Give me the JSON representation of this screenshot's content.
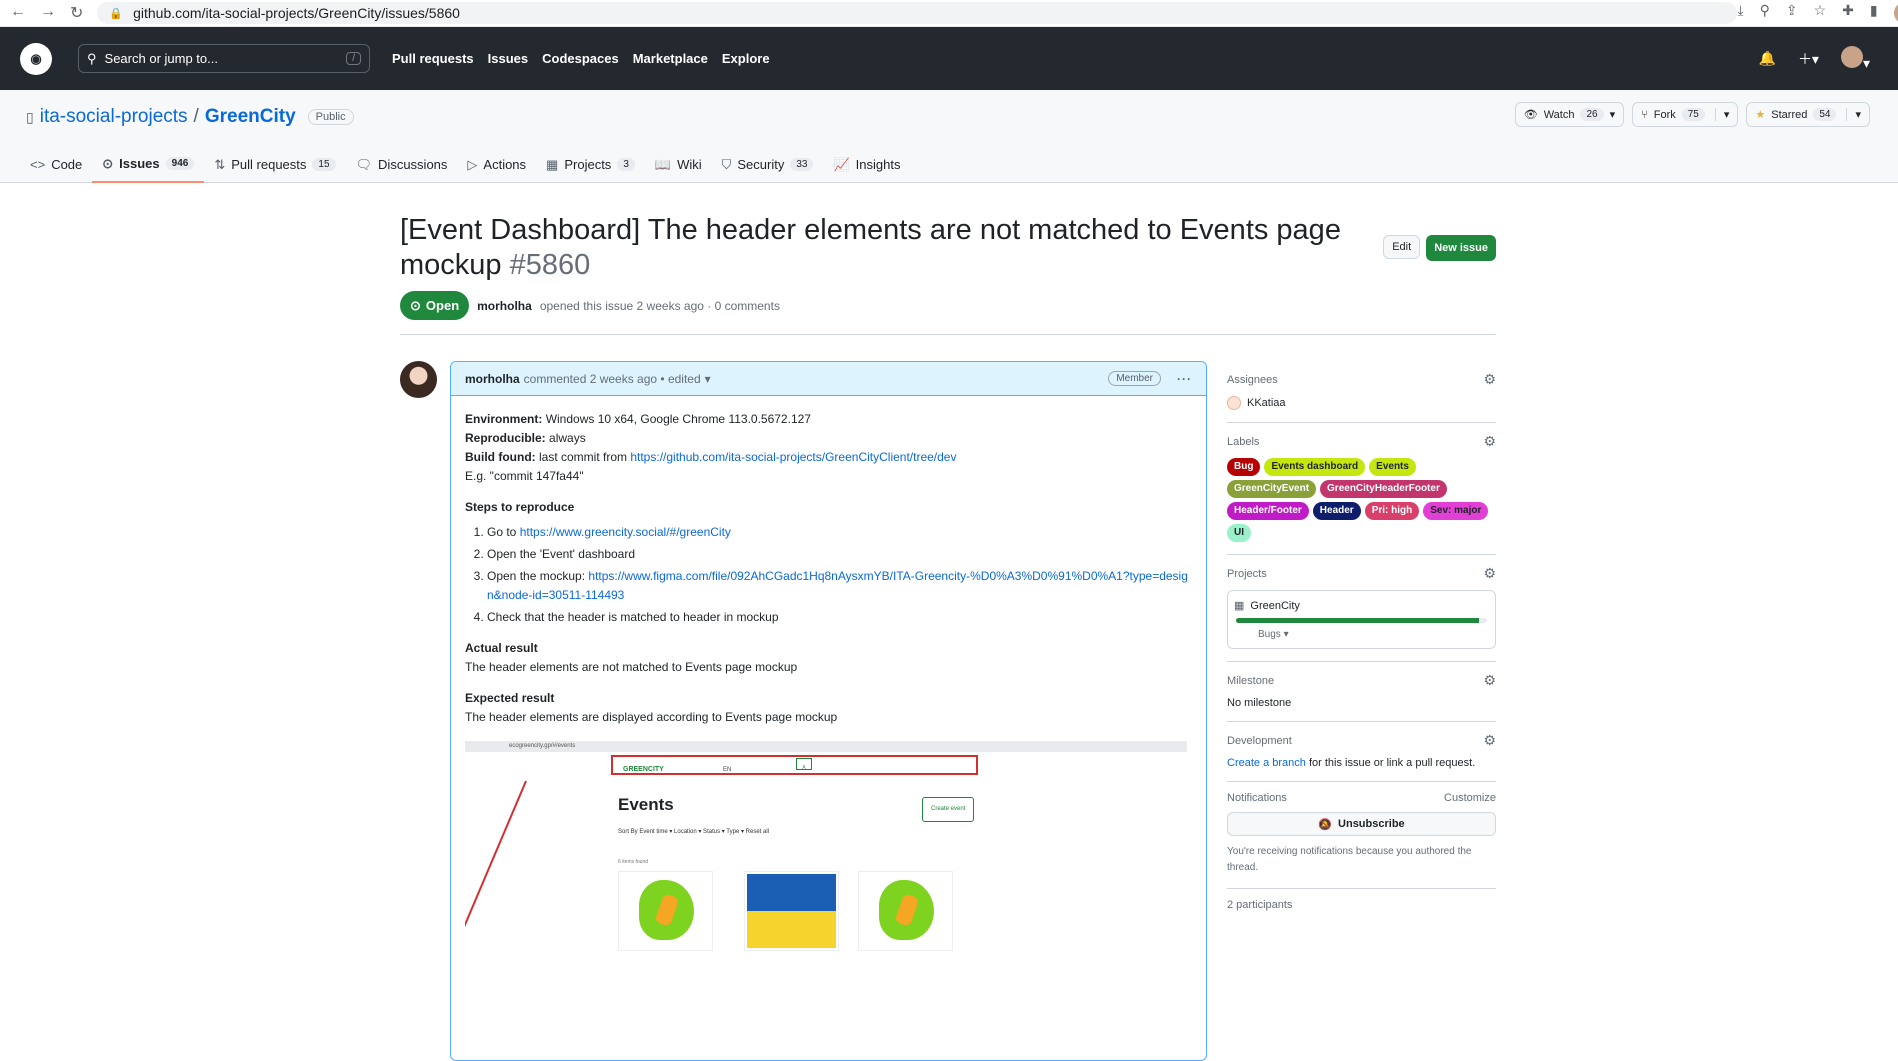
{
  "browser": {
    "url": "github.com/ita-social-projects/GreenCity/issues/5860"
  },
  "header": {
    "search_placeholder": "Search or jump to...",
    "search_shortcut": "/",
    "nav": [
      "Pull requests",
      "Issues",
      "Codespaces",
      "Marketplace",
      "Explore"
    ]
  },
  "repo": {
    "owner": "ita-social-projects",
    "separator": "/",
    "name": "GreenCity",
    "visibility": "Public",
    "watch": {
      "label": "Watch",
      "count": "26"
    },
    "fork": {
      "label": "Fork",
      "count": "75"
    },
    "star": {
      "label": "Starred",
      "count": "54"
    },
    "tabs": [
      {
        "label": "Code",
        "count": ""
      },
      {
        "label": "Issues",
        "count": "946"
      },
      {
        "label": "Pull requests",
        "count": "15"
      },
      {
        "label": "Discussions",
        "count": ""
      },
      {
        "label": "Actions",
        "count": ""
      },
      {
        "label": "Projects",
        "count": "3"
      },
      {
        "label": "Wiki",
        "count": ""
      },
      {
        "label": "Security",
        "count": "33"
      },
      {
        "label": "Insights",
        "count": ""
      }
    ]
  },
  "issue": {
    "title": "[Event Dashboard] The header elements are not matched to Events page mockup",
    "number": "#5860",
    "state": "Open",
    "author": "morholha",
    "meta_text": "opened this issue 2 weeks ago · 0 comments",
    "edit_label": "Edit",
    "new_issue_label": "New issue"
  },
  "comment": {
    "author": "morholha",
    "meta": "commented 2 weeks ago • edited",
    "role": "Member",
    "env_label": "Environment:",
    "env_value": "Windows 10 x64, Google Chrome 113.0.5672.127",
    "repro_label": "Reproducible:",
    "repro_value": "always",
    "build_label": "Build found:",
    "build_value": "last commit from",
    "build_link": "https://github.com/ita-social-projects/GreenCityClient/tree/dev",
    "example": "E.g. \"commit 147fa44\"",
    "steps_title": "Steps to reproduce",
    "step1_text": "Go to",
    "step1_link": "https://www.greencity.social/#/greenCity",
    "step2": "Open the 'Event' dashboard",
    "step3_text": "Open the mockup:",
    "step3_link": "https://www.figma.com/file/092AhCGadc1Hq8nAysxmYB/ITA-Greencity-%D0%A3%D0%91%D0%A1?type=design&node-id=30511-114493",
    "step4": "Check that the header is matched to header in mockup",
    "actual_title": "Actual result",
    "actual_text": "The header elements are not matched to Events page mockup",
    "expected_title": "Expected result",
    "expected_text": "The header elements are displayed according to Events page mockup",
    "screenshot": {
      "url": "ecogreencity.gp/#/events",
      "logo": "GREENCITY",
      "lang": "EN",
      "heading": "Events",
      "create": "Create event",
      "sort": "Sort By   Event time ▾   Location ▾   Status ▾   Type ▾   Reset all",
      "found": "6 items found"
    }
  },
  "sidebar": {
    "assignees_title": "Assignees",
    "assignee": "KKatiaa",
    "labels_title": "Labels",
    "labels": [
      {
        "name": "Bug",
        "bg": "#b60205",
        "fg": "#ffffff"
      },
      {
        "name": "Events dashboard",
        "bg": "#c5e60f",
        "fg": "#1f2328"
      },
      {
        "name": "Events",
        "bg": "#c5e60f",
        "fg": "#1f2328"
      },
      {
        "name": "GreenCityEvent",
        "bg": "#8aa13a",
        "fg": "#ffffff"
      },
      {
        "name": "GreenCityHeaderFooter",
        "bg": "#c2366d",
        "fg": "#ffffff"
      },
      {
        "name": "Header/Footer",
        "bg": "#c11bc7",
        "fg": "#ffffff"
      },
      {
        "name": "Header",
        "bg": "#0e1e6b",
        "fg": "#ffffff"
      },
      {
        "name": "Pri: high",
        "bg": "#d93f6b",
        "fg": "#ffffff"
      },
      {
        "name": "Sev: major",
        "bg": "#e23fd4",
        "fg": "#1f2328"
      },
      {
        "name": "UI",
        "bg": "#9af0c9",
        "fg": "#1f2328"
      }
    ],
    "projects_title": "Projects",
    "project_name": "GreenCity",
    "project_progress": 0.97,
    "project_status": "Bugs ▾",
    "milestone_title": "Milestone",
    "milestone_value": "No milestone",
    "development_title": "Development",
    "development_link": "Create a branch",
    "development_text": "for this issue or link a pull request.",
    "notifications_title": "Notifications",
    "customize": "Customize",
    "unsubscribe": "Unsubscribe",
    "notif_text": "You're receiving notifications because you authored the thread.",
    "participants": "2 participants"
  }
}
